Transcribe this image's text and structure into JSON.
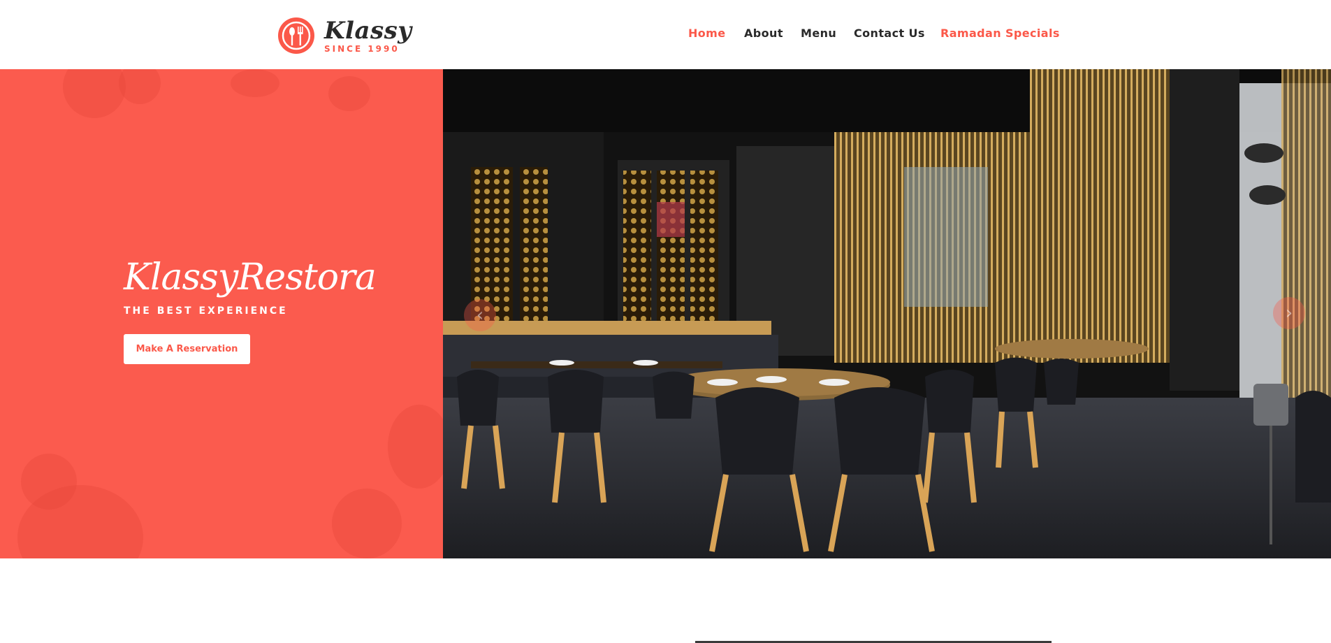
{
  "brand": {
    "name": "Klassy",
    "since": "SINCE 1990"
  },
  "nav": {
    "items": [
      {
        "label": "Home"
      },
      {
        "label": "About"
      },
      {
        "label": "Menu"
      },
      {
        "label": "Contact Us"
      },
      {
        "label": "Ramadan Specials"
      }
    ]
  },
  "hero": {
    "title": "KlassyRestora",
    "subtitle": "THE BEST EXPERIENCE",
    "cta_label": "Make A Reservation",
    "prev_icon": "‹",
    "next_icon": "›"
  },
  "colors": {
    "accent": "#fb5849",
    "hero_bg": "#fb5b4e",
    "text_dark": "#2a2a2a"
  },
  "icons": [
    "restaurant-logo-icon",
    "chevron-left-icon",
    "chevron-right-icon"
  ]
}
